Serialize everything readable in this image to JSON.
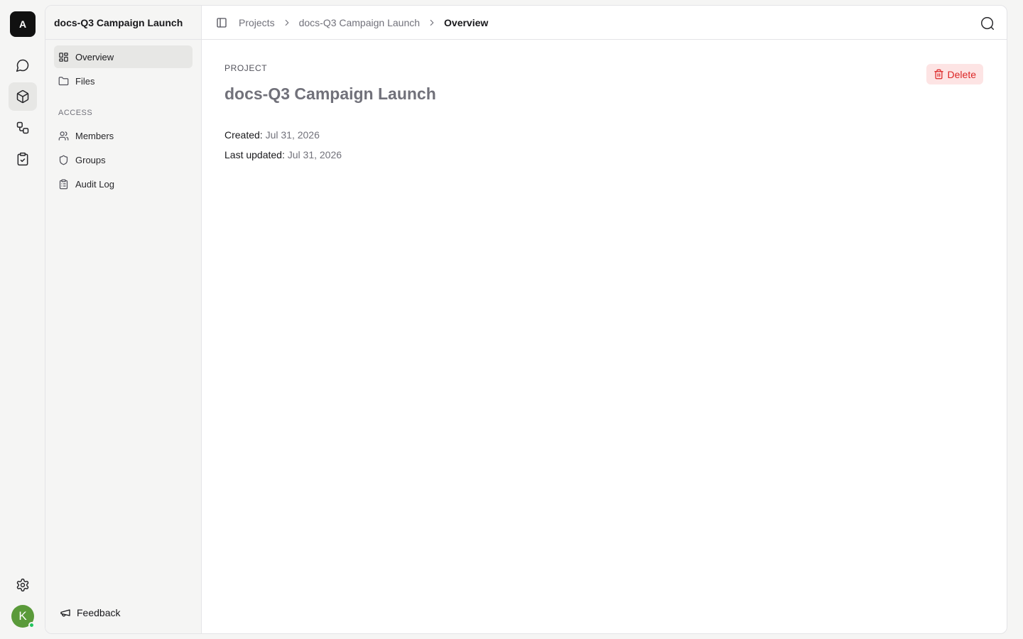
{
  "rail": {
    "workspace_initial": "A",
    "items": [
      {
        "name": "chat-bubble-icon",
        "active": false
      },
      {
        "name": "cube-icon",
        "active": true
      },
      {
        "name": "workflow-icon",
        "active": false
      },
      {
        "name": "clipboard-check-icon",
        "active": false
      }
    ],
    "settings_icon": "gear-icon",
    "user_initial": "K",
    "user_status_color": "#22c55e",
    "avatar_color": "#5a9a3a"
  },
  "sidebar": {
    "project_title": "docs-Q3 Campaign Launch",
    "items": [
      {
        "label": "Overview",
        "icon": "layout-dashboard-icon",
        "active": true
      },
      {
        "label": "Files",
        "icon": "folder-icon",
        "active": false
      }
    ],
    "access_section_label": "ACCESS",
    "access_items": [
      {
        "label": "Members",
        "icon": "users-icon"
      },
      {
        "label": "Groups",
        "icon": "shield-icon"
      },
      {
        "label": "Audit Log",
        "icon": "clipboard-list-icon"
      }
    ],
    "feedback_label": "Feedback"
  },
  "topbar": {
    "breadcrumb": [
      "Projects",
      "docs-Q3 Campaign Launch",
      "Overview"
    ]
  },
  "main": {
    "eyebrow": "PROJECT",
    "title": "docs-Q3 Campaign Launch",
    "delete_label": "Delete",
    "created_label": "Created:",
    "created_value": "Jul 31, 2026",
    "updated_label": "Last updated:",
    "updated_value": "Jul 31, 2026"
  },
  "colors": {
    "danger": "#dc2626",
    "danger_bg": "#fde4e4",
    "active_bg": "#e7e7e5"
  }
}
